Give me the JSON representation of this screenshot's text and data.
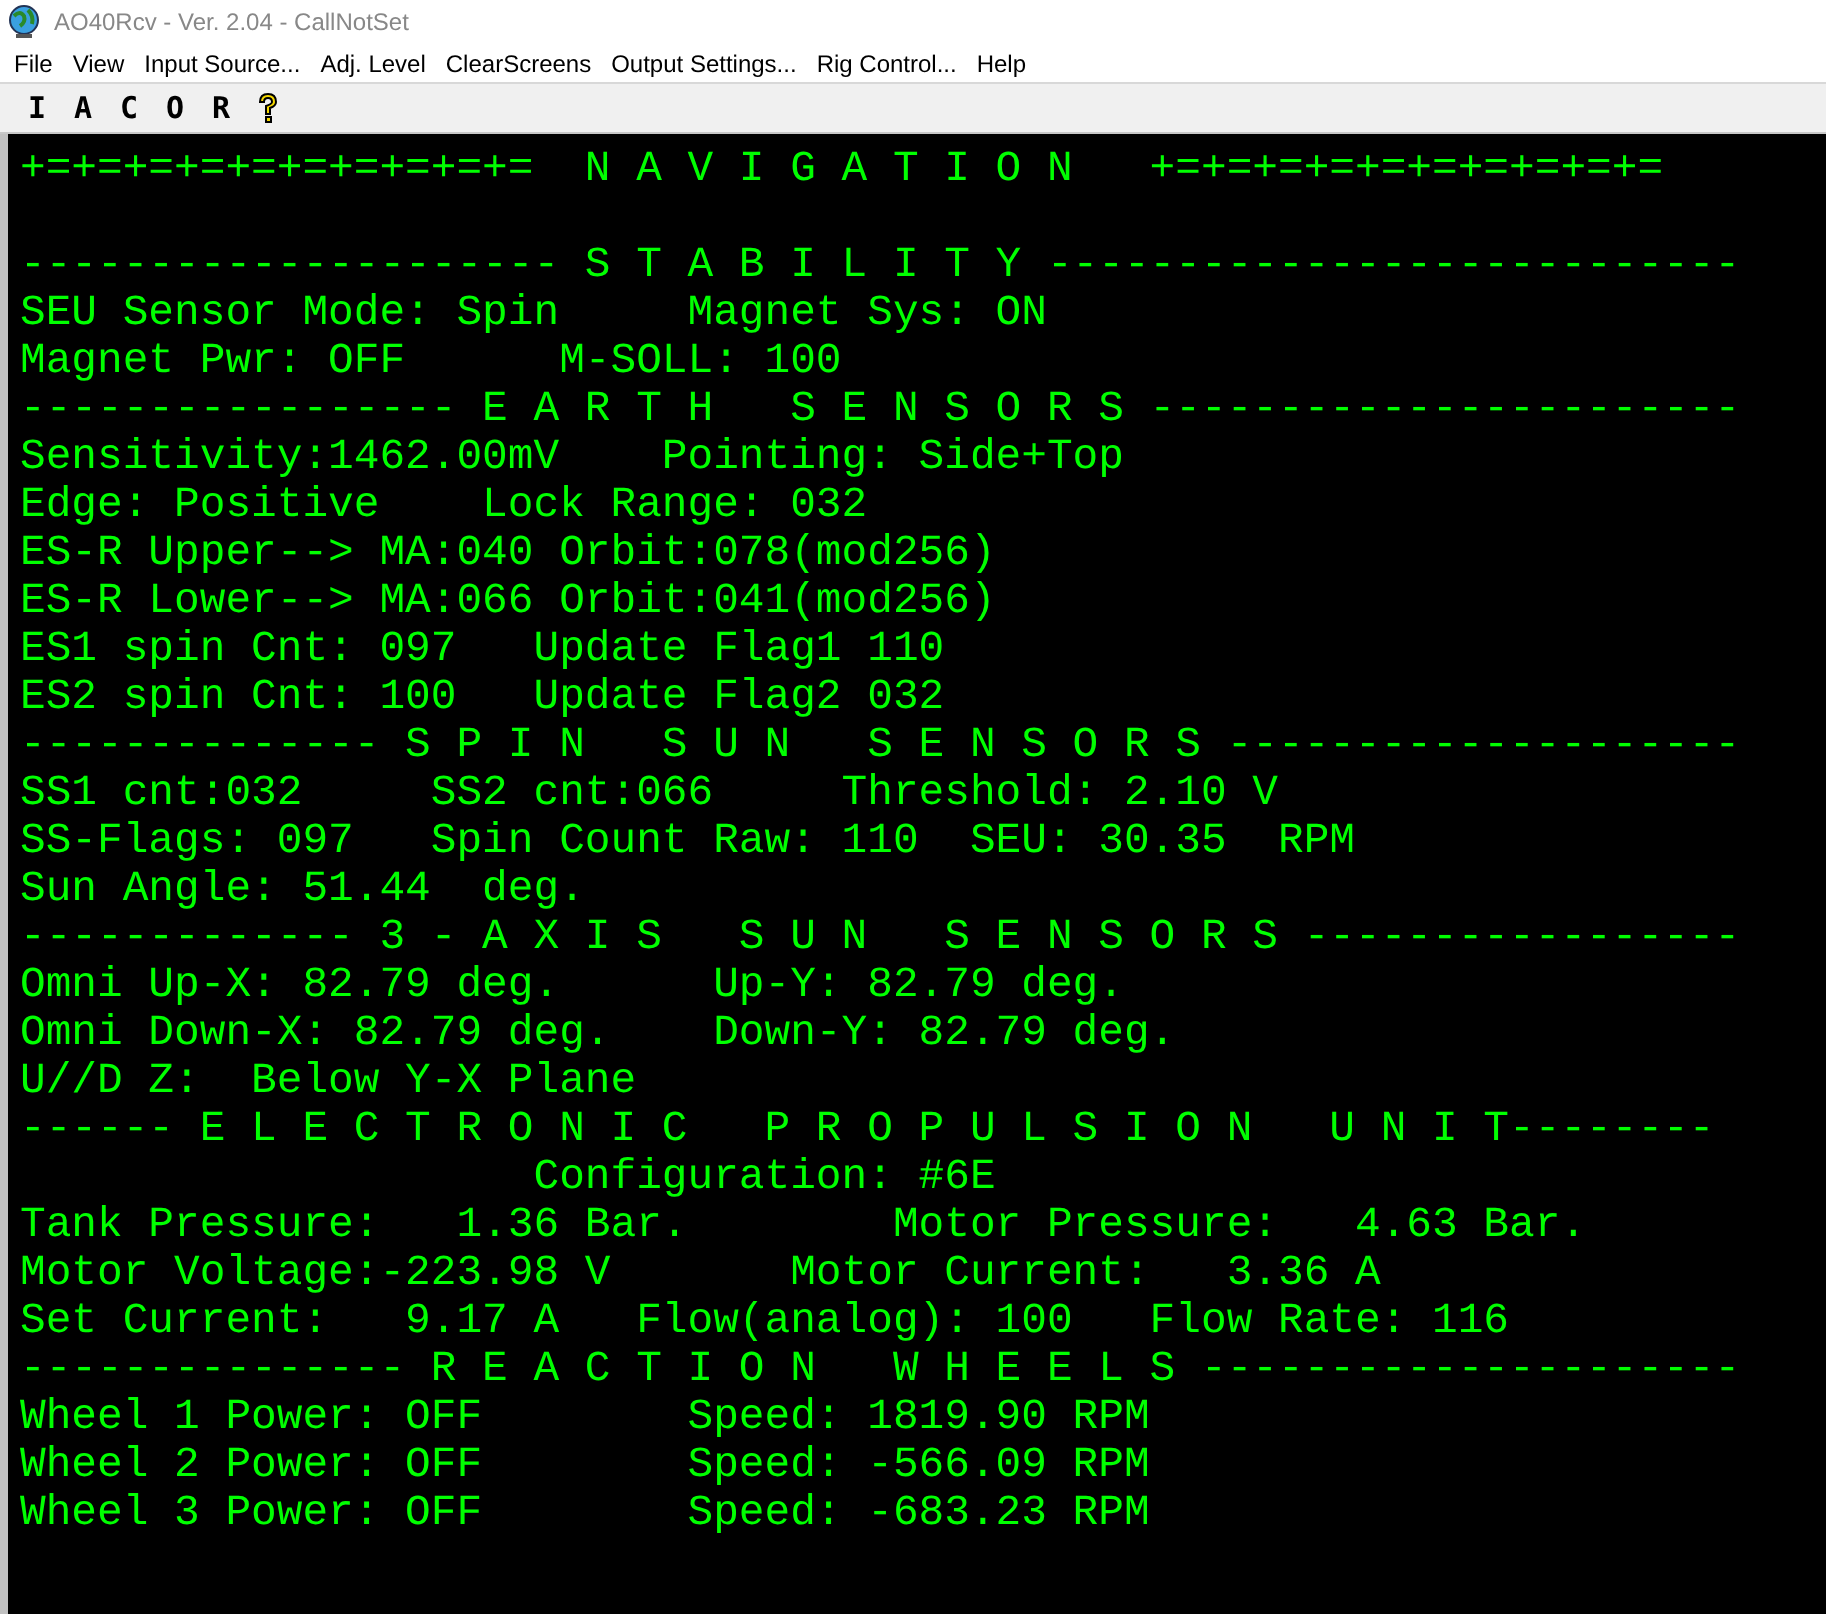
{
  "window": {
    "title": "AO40Rcv - Ver. 2.04 - CallNotSet"
  },
  "menu": [
    "File",
    "View",
    "Input Source...",
    "Adj. Level",
    "ClearScreens",
    "Output Settings...",
    "Rig Control...",
    "Help"
  ],
  "toolbar": [
    {
      "kind": "letter",
      "label": "I"
    },
    {
      "kind": "letter",
      "label": "A"
    },
    {
      "kind": "letter",
      "label": "C"
    },
    {
      "kind": "letter",
      "label": "O"
    },
    {
      "kind": "letter",
      "label": "R"
    },
    {
      "kind": "help"
    }
  ],
  "terminal": {
    "banner": "+=+=+=+=+=+=+=+=+=+=  N A V I G A T I O N   +=+=+=+=+=+=+=+=+=+=",
    "sections": [
      {
        "header": "--------------------- S T A B I L I T Y ---------------------------",
        "lines": [
          "SEU Sensor Mode: Spin     Magnet Sys: ON",
          "Magnet Pwr: OFF      M-SOLL: 100"
        ]
      },
      {
        "header": "----------------- E A R T H   S E N S O R S -----------------------",
        "lines": [
          "Sensitivity:1462.00mV    Pointing: Side+Top",
          "Edge: Positive    Lock Range: 032",
          "ES-R Upper--> MA:040 Orbit:078(mod256)",
          "ES-R Lower--> MA:066 Orbit:041(mod256)",
          "ES1 spin Cnt: 097   Update Flag1 110",
          "ES2 spin Cnt: 100   Update Flag2 032"
        ]
      },
      {
        "header": "-------------- S P I N   S U N   S E N S O R S --------------------",
        "lines": [
          "SS1 cnt:032     SS2 cnt:066     Threshold: 2.10 V",
          "SS-Flags: 097   Spin Count Raw: 110  SEU: 30.35  RPM",
          "Sun Angle: 51.44  deg."
        ]
      },
      {
        "header": "------------- 3 - A X I S   S U N   S E N S O R S -----------------",
        "lines": [
          "Omni Up-X: 82.79 deg.      Up-Y: 82.79 deg.",
          "Omni Down-X: 82.79 deg.    Down-Y: 82.79 deg.",
          "U//D Z:  Below Y-X Plane"
        ]
      },
      {
        "header": "------ E L E C T R O N I C   P R O P U L S I O N   U N I T--------",
        "lines": [
          "                    Configuration: #6E",
          "Tank Pressure:   1.36 Bar.        Motor Pressure:   4.63 Bar.",
          "Motor Voltage:-223.98 V       Motor Current:   3.36 A",
          "Set Current:   9.17 A   Flow(analog): 100   Flow Rate: 116"
        ]
      },
      {
        "header": "--------------- R E A C T I O N   W H E E L S ---------------------",
        "lines": [
          "Wheel 1 Power: OFF        Speed: 1819.90 RPM",
          "Wheel 2 Power: OFF        Speed: -566.09 RPM",
          "Wheel 3 Power: OFF        Speed: -683.23 RPM"
        ]
      }
    ]
  }
}
